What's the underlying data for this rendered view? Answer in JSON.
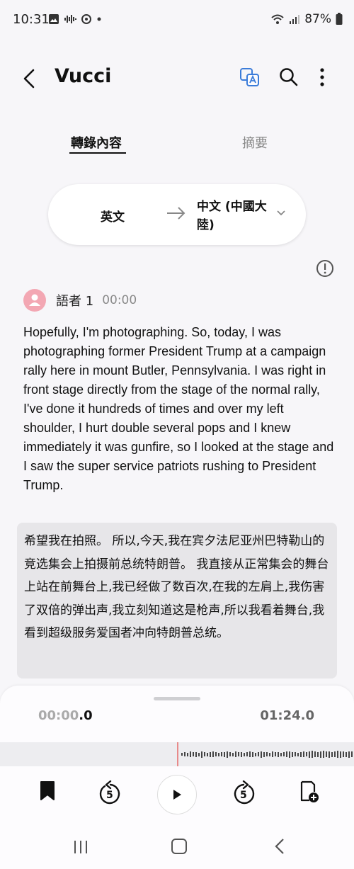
{
  "status_bar": {
    "time": "10:31",
    "battery": "87%"
  },
  "app_bar": {
    "title": "Vucci"
  },
  "tabs": [
    {
      "label": "轉錄內容",
      "active": true
    },
    {
      "label": "摘要",
      "active": false
    }
  ],
  "language": {
    "from": "英文",
    "to": "中文 (中國大陸)"
  },
  "speaker": {
    "name": "語者 1",
    "time": "00:00"
  },
  "transcript": "Hopefully, I'm photographing. So, today, I was photographing former President Trump at a campaign rally here in mount Butler, Pennsylvania. I was right in front stage directly from the stage of the normal rally, I've done it hundreds of times and over my left shoulder, I hurt double several pops and I knew immediately it was gunfire, so I looked at the stage and I saw the super service patriots rushing to President Trump.",
  "translation": "希望我在拍照。 所以,今天,我在宾夕法尼亚州巴特勒山的竞选集会上拍摄前总统特朗普。 我直接从正常集会的舞台上站在前舞台上,我已经做了数百次,在我的左肩上,我伤害了双倍的弹出声,我立刻知道这是枪声,所以我看着舞台,我看到超级服务爱国者冲向特朗普总统。",
  "player": {
    "current_time_dim": "00:00",
    "current_time_ms": ".0",
    "total_time": "01:24.0",
    "skip_back": "5",
    "skip_forward": "5"
  },
  "colors": {
    "accent": "#3b7cd9",
    "avatar": "#f3a7b3",
    "playhead": "#e88a8a"
  }
}
